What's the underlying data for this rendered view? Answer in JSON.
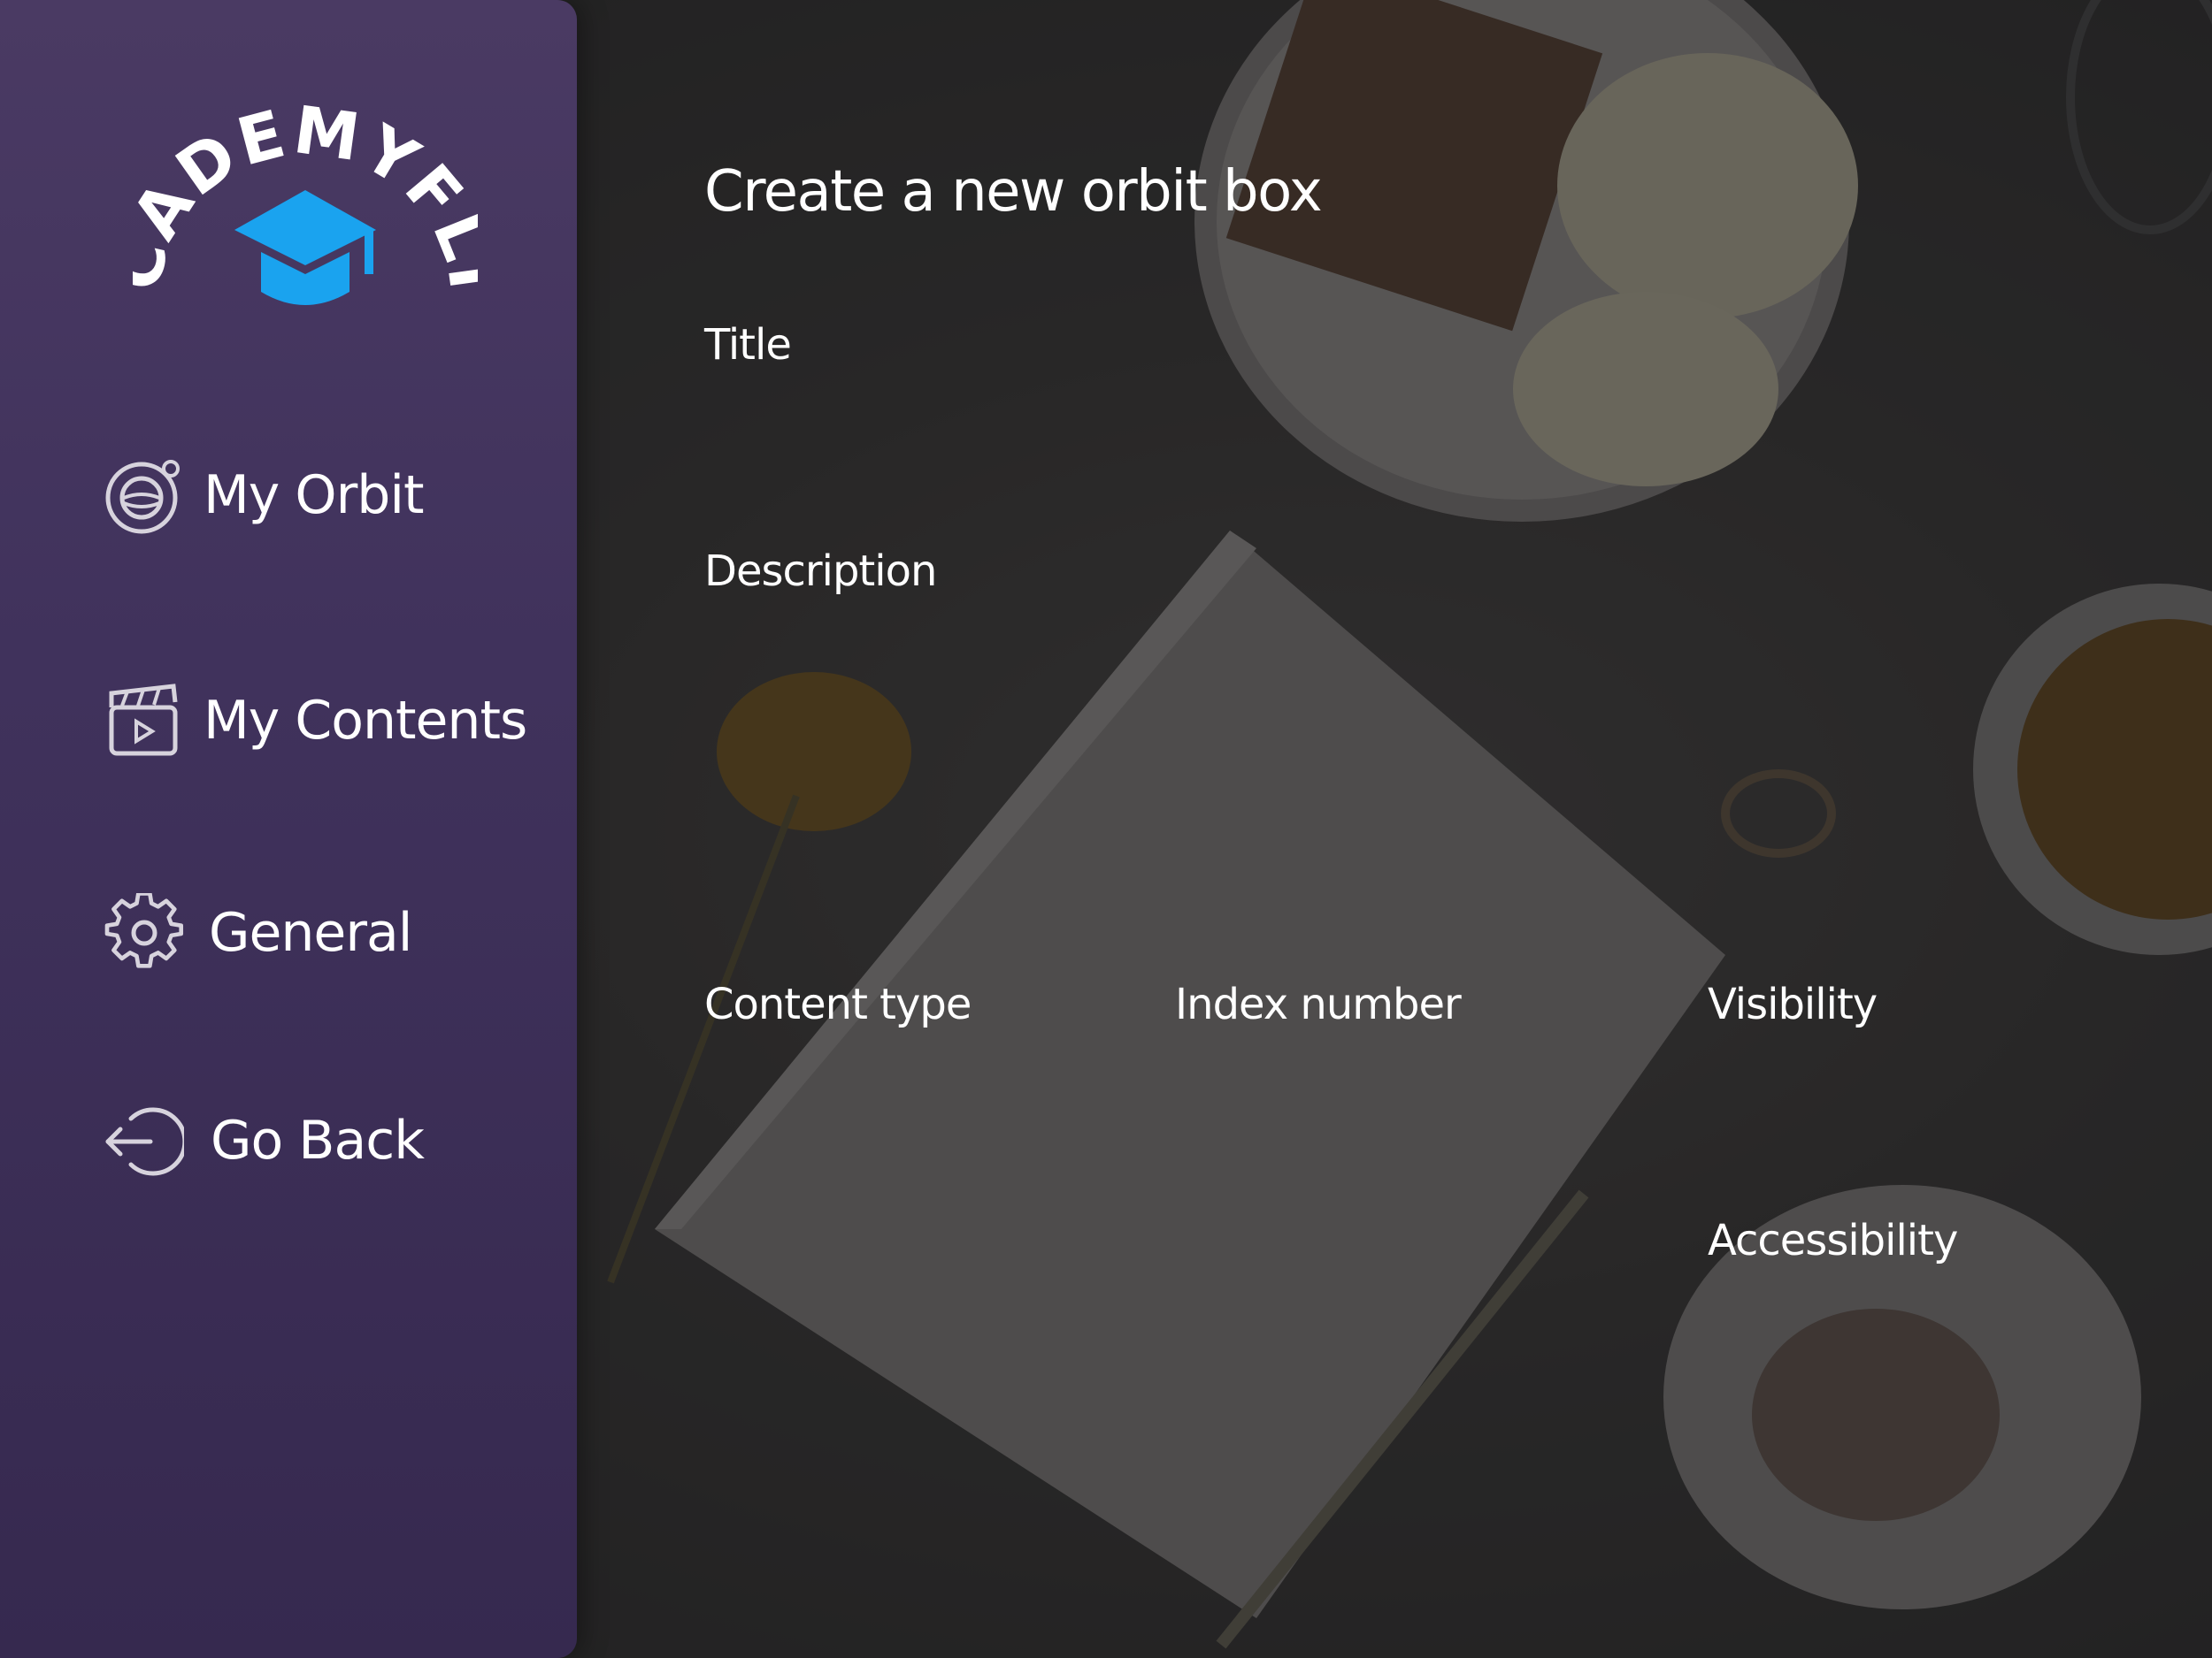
{
  "app": {
    "brand": "ACADEMYFLIX",
    "accent_color": "#1aa3ef",
    "sidebar_gradient": [
      "#4a3a63",
      "#36294f"
    ]
  },
  "sidebar": {
    "items": [
      {
        "label": "My Orbit",
        "icon": "orbit-icon"
      },
      {
        "label": "My Contents",
        "icon": "clapperboard-icon"
      },
      {
        "label": "General",
        "icon": "gear-icon"
      },
      {
        "label": "Go Back",
        "icon": "logout-arrow-icon"
      }
    ]
  },
  "main": {
    "title": "Create a new orbit box",
    "fields": {
      "title": "Title",
      "description": "Description",
      "content_type": "Content type",
      "index_number": "Index number",
      "visibility": "Visibility",
      "accessibility": "Accessibility"
    }
  }
}
